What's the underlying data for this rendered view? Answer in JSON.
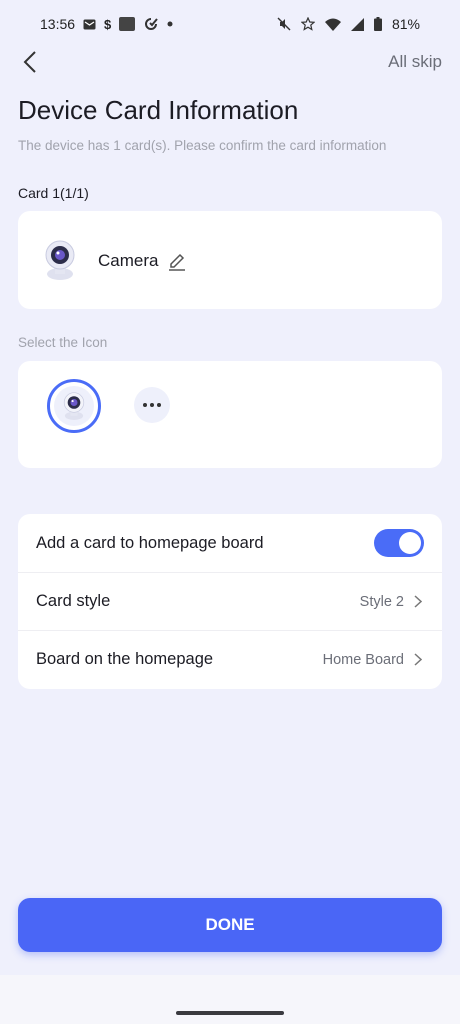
{
  "status_bar": {
    "time": "13:56",
    "battery": "81%",
    "icons_left": [
      "gmail-icon",
      "s-icon",
      "app-icon",
      "circle-check-icon",
      "dot-icon"
    ],
    "icons_right": [
      "mute-icon",
      "star-icon",
      "wifi-icon",
      "signal-icon",
      "battery-icon"
    ]
  },
  "nav": {
    "skip_label": "All skip"
  },
  "page": {
    "title": "Device Card Information",
    "subtitle": "The device has 1 card(s). Please confirm the card information"
  },
  "card": {
    "label": "Card 1(1/1)",
    "device_name": "Camera",
    "device_icon": "camera-icon"
  },
  "icon_select": {
    "label": "Select the Icon",
    "options": [
      "camera-icon",
      "more-icon"
    ]
  },
  "settings": {
    "add_card_label": "Add a card to homepage board",
    "add_card_enabled": true,
    "card_style_label": "Card style",
    "card_style_value": "Style 2",
    "board_label": "Board on the homepage",
    "board_value": "Home Board"
  },
  "footer": {
    "done_label": "DONE"
  },
  "colors": {
    "accent": "#4a66f6",
    "background": "#eff0fc",
    "card": "#ffffff"
  }
}
